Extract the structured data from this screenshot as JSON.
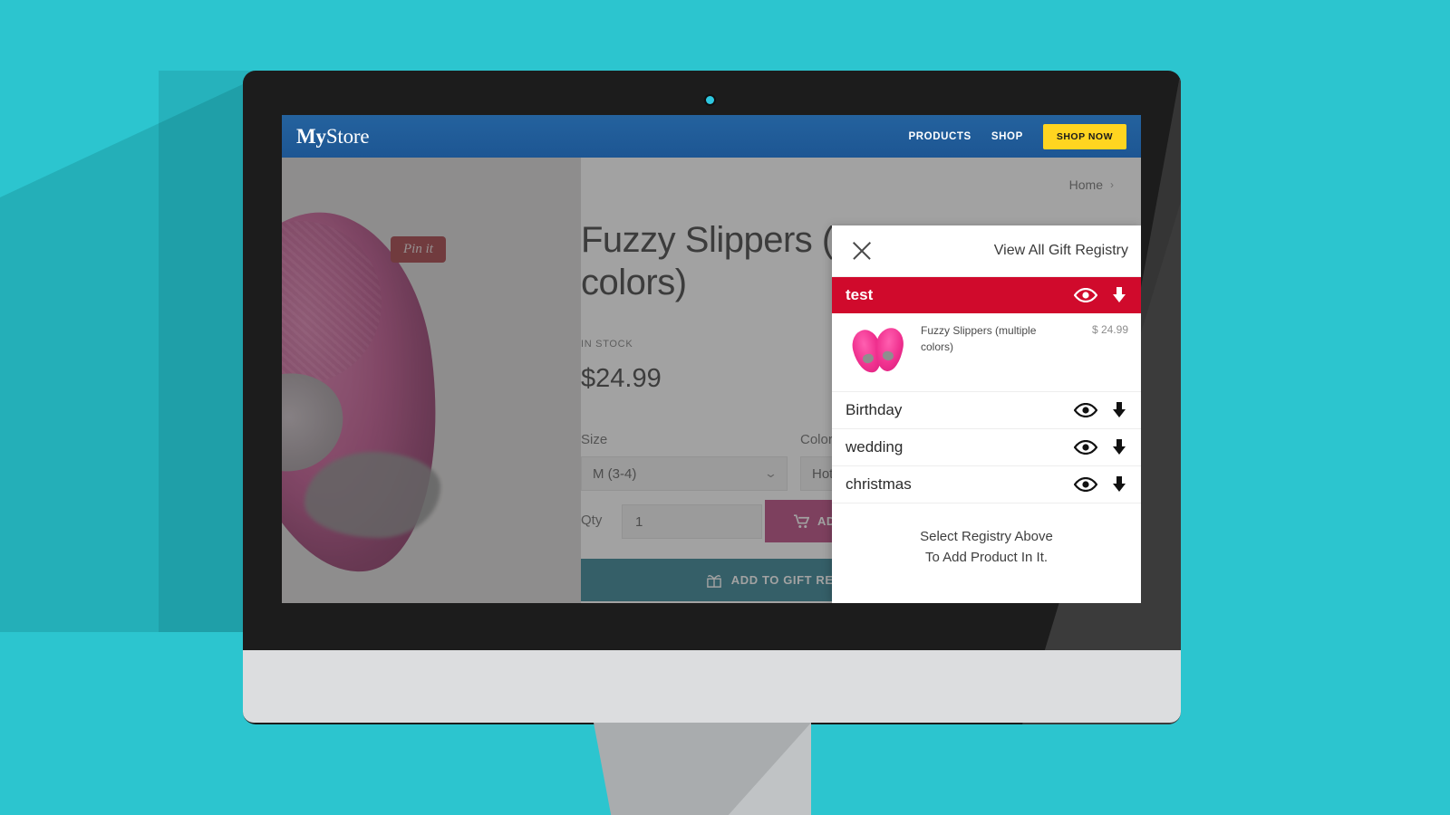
{
  "site": {
    "brand_bold": "My",
    "brand_light": "Store",
    "nav": [
      {
        "label": "PRODUCTS"
      },
      {
        "label": "SHOP"
      }
    ],
    "shop_now_label": "SHOP NOW",
    "header_bg": "#1f5c99",
    "shop_now_bg": "#ffd520"
  },
  "breadcrumb": {
    "home": "Home",
    "separator": "›"
  },
  "product": {
    "title": "Fuzzy Slippers (multiple colors)",
    "stock": "IN STOCK",
    "price": "$24.99",
    "pin_it": "Pin it",
    "size_label": "Size",
    "size_value": "M (3-4)",
    "color_label": "Color",
    "color_value": "Hot Pink",
    "qty_label": "Qty",
    "qty_value": "1",
    "add_to_cart_label": "ADD TO CART",
    "add_to_registry_label": "ADD TO GIFT REGISTRY",
    "cart_color": "#b8437e",
    "registry_color": "#2f7f90",
    "chevron": "⌄"
  },
  "registry_panel": {
    "title": "View All Gift Registry",
    "close_icon": "close-icon",
    "hint_line1": "Select Registry Above",
    "hint_line2": "To Add Product In It.",
    "active_bg": "#d00a2c",
    "rows": [
      {
        "name": "test",
        "active": true
      },
      {
        "name": "Birthday",
        "active": false
      },
      {
        "name": "wedding",
        "active": false
      },
      {
        "name": "christmas",
        "active": false
      }
    ],
    "item": {
      "name": "Fuzzy Slippers (multiple colors)",
      "price": "$ 24.99"
    }
  },
  "scene": {
    "background_color": "#2cc5cf",
    "bezel_color": "#1c1c1c",
    "chin_color": "#dcdddf"
  }
}
